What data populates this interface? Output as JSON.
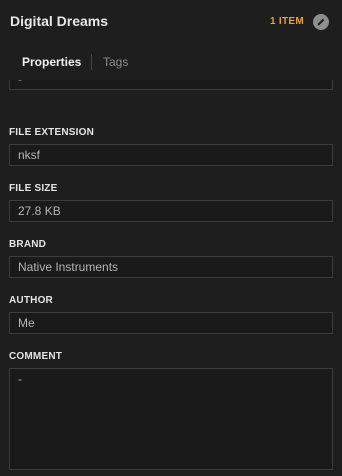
{
  "header": {
    "title": "Digital Dreams",
    "item_count": "1 ITEM",
    "edit_icon": "pencil-icon"
  },
  "tabs": [
    {
      "label": "Properties",
      "active": true
    },
    {
      "label": "Tags",
      "active": false
    }
  ],
  "fields": {
    "partial_value": "-",
    "file_extension": {
      "label": "FILE EXTENSION",
      "value": "nksf"
    },
    "file_size": {
      "label": "FILE SIZE",
      "value": "27.8 KB"
    },
    "brand": {
      "label": "BRAND",
      "value": "Native Instruments"
    },
    "author": {
      "label": "AUTHOR",
      "value": "Me"
    },
    "comment": {
      "label": "COMMENT",
      "value": "-"
    }
  },
  "colors": {
    "background": "#1e1e1e",
    "accent": "#f0a020",
    "field_border": "#3c3c3c"
  }
}
